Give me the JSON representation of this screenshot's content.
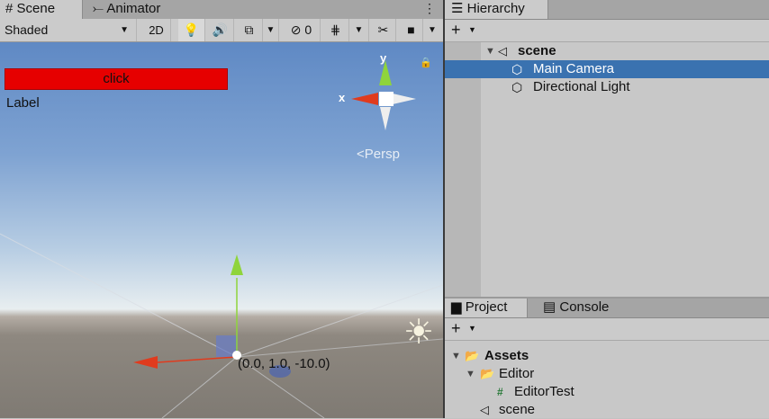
{
  "scene_tabs": {
    "scene": "Scene",
    "animator": "Animator"
  },
  "toolbar": {
    "shading_mode": "Shaded",
    "mode_2d": "2D",
    "hidden_count": "0"
  },
  "game_ui": {
    "button_label": "click",
    "label_text": "Label"
  },
  "gizmo": {
    "y_axis": "y",
    "x_axis": "x",
    "projection": "Persp"
  },
  "selection": {
    "position_readout": "(0.0, 1.0, -10.0)"
  },
  "hierarchy": {
    "tab": "Hierarchy",
    "scene_name": "scene",
    "items": [
      {
        "label": "Main Camera",
        "selected": true
      },
      {
        "label": "Directional Light",
        "selected": false
      }
    ]
  },
  "project": {
    "tabs": {
      "project": "Project",
      "console": "Console"
    },
    "tree": {
      "assets": "Assets",
      "editor": "Editor",
      "script": "EditorTest",
      "scene": "scene"
    }
  },
  "colors": {
    "selection": "#3a72b0",
    "game_button": "#e60000",
    "x_axis": "#e03b1e",
    "y_axis": "#8fd43b"
  }
}
